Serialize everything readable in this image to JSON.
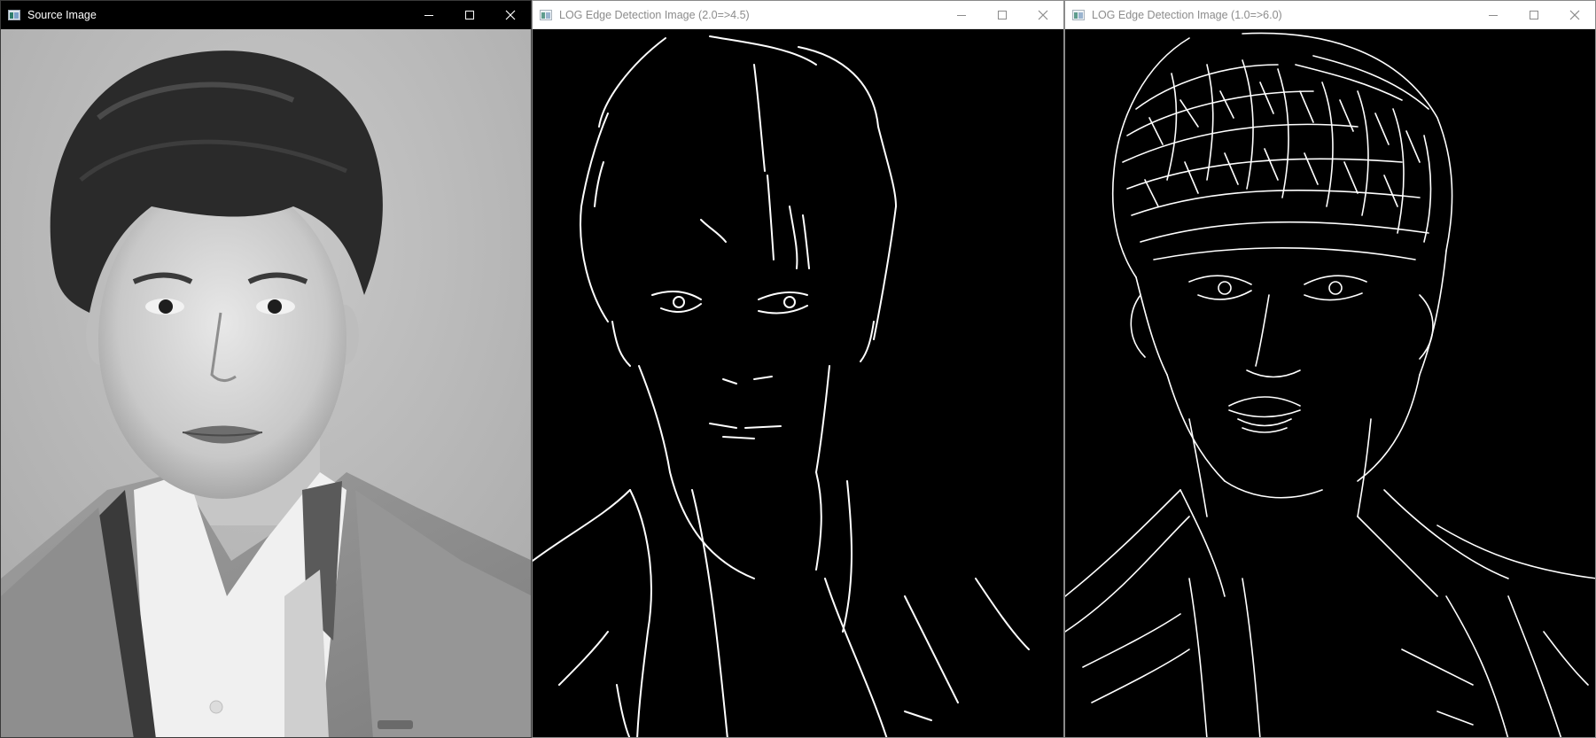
{
  "windows": [
    {
      "title": "Source Image",
      "state": "active",
      "content": "grayscale-portrait-photo",
      "controls": {
        "minimize": "minimize-icon",
        "maximize": "maximize-icon",
        "close": "close-icon"
      }
    },
    {
      "title": "LOG Edge Detection Image (2.0=>4.5)",
      "state": "inactive",
      "content": "sparse-edge-map",
      "controls": {
        "minimize": "minimize-icon",
        "maximize": "maximize-icon",
        "close": "close-icon"
      }
    },
    {
      "title": "LOG Edge Detection Image (1.0=>6.0)",
      "state": "inactive",
      "content": "dense-edge-map",
      "controls": {
        "minimize": "minimize-icon",
        "maximize": "maximize-icon",
        "close": "close-icon"
      }
    }
  ],
  "colors": {
    "active_titlebar": "#000000",
    "inactive_titlebar": "#ffffff",
    "edge_background": "#000000",
    "edge_lines": "#ffffff"
  }
}
